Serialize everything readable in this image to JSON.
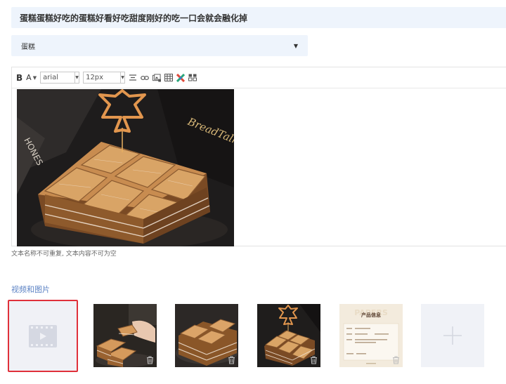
{
  "title": {
    "value": "蛋糕蛋糕好吃的蛋糕好看好吃甜度刚好的吃一口会就会融化掉"
  },
  "category": {
    "selected": "蛋糕"
  },
  "editor": {
    "toolbar": {
      "bold": "B",
      "font_color": "A",
      "font_family": "arial",
      "font_size": "12px"
    },
    "image_brand_text": "BreadTalk",
    "image_box_text": "HONES"
  },
  "hint": "文本名称不可重复, 文本内容不可为空",
  "media": {
    "label": "视频和图片",
    "thumbs": [
      {
        "type": "video-placeholder"
      },
      {
        "type": "image",
        "icon": "trash-icon"
      },
      {
        "type": "image",
        "icon": "trash-icon"
      },
      {
        "type": "image",
        "icon": "trash-icon"
      },
      {
        "type": "image",
        "icon": "trash-icon",
        "title": "产品信息",
        "watermark": "PAPERS"
      },
      {
        "type": "add",
        "icon": "plus-icon"
      }
    ]
  },
  "colors": {
    "field_bg": "#eef4fc",
    "accent_blue": "#5b82c4",
    "selection_red": "#e0303a"
  }
}
